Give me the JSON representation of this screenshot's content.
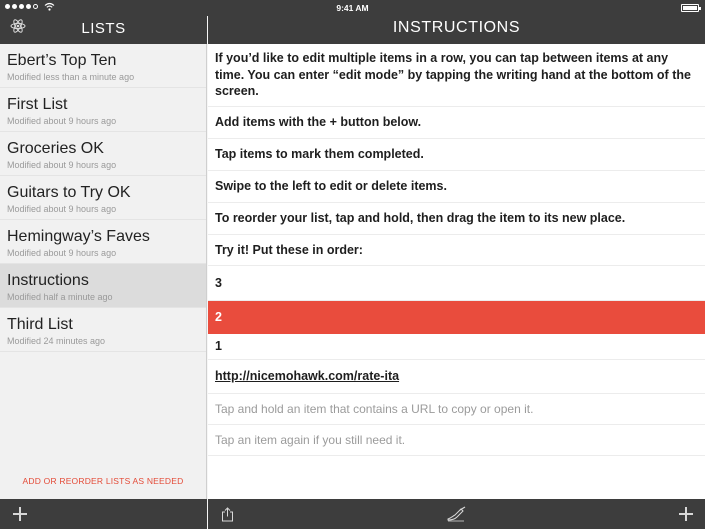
{
  "status_bar": {
    "time": "9:41 AM"
  },
  "sidebar": {
    "title": "LISTS",
    "items": [
      {
        "name": "Ebert’s Top Ten",
        "modified": "Modified less than a minute ago",
        "selected": false
      },
      {
        "name": "First List",
        "modified": "Modified about 9 hours ago",
        "selected": false
      },
      {
        "name": "Groceries OK",
        "modified": "Modified about 9 hours ago",
        "selected": false
      },
      {
        "name": "Guitars to Try OK",
        "modified": "Modified about 9 hours ago",
        "selected": false
      },
      {
        "name": "Hemingway’s Faves",
        "modified": "Modified about 9 hours ago",
        "selected": false
      },
      {
        "name": "Instructions",
        "modified": "Modified half a minute ago",
        "selected": true
      },
      {
        "name": "Third List",
        "modified": "Modified 24 minutes ago",
        "selected": false
      }
    ],
    "hint": "ADD OR REORDER LISTS AS NEEDED"
  },
  "main": {
    "title": "INSTRUCTIONS",
    "items": [
      {
        "text": "If you’d like to edit multiple items in a row, you can tap between items at any time. You can enter “edit mode” by tapping the writing hand at the bottom of the screen.",
        "style": "bold"
      },
      {
        "text": "Add items with the + button below.",
        "style": "bold"
      },
      {
        "text": "Tap items to mark them completed.",
        "style": "bold"
      },
      {
        "text": "Swipe to the left to edit or delete items.",
        "style": "bold"
      },
      {
        "text": "To reorder your list, tap and hold, then drag the item to its new place.",
        "style": "bold"
      },
      {
        "text": "Try it! Put these in order:",
        "style": "bold"
      },
      {
        "text": "3",
        "style": "bold"
      },
      {
        "text": "2",
        "style": "highlight"
      },
      {
        "text": "1",
        "style": "bold"
      },
      {
        "text": "http://nicemohawk.com/rate-ita",
        "style": "link"
      },
      {
        "text": "Tap and hold an item that contains a URL to copy or open it.",
        "style": "note"
      },
      {
        "text": "Tap an item again if you still need it.",
        "style": "note"
      }
    ]
  },
  "colors": {
    "bar": "#3d3d3d",
    "accent": "#e94c3d",
    "hint": "#e44b38"
  },
  "icons": [
    "atom-icon",
    "plus-icon",
    "share-icon",
    "writing-hand-icon",
    "wifi-icon",
    "battery-icon"
  ]
}
